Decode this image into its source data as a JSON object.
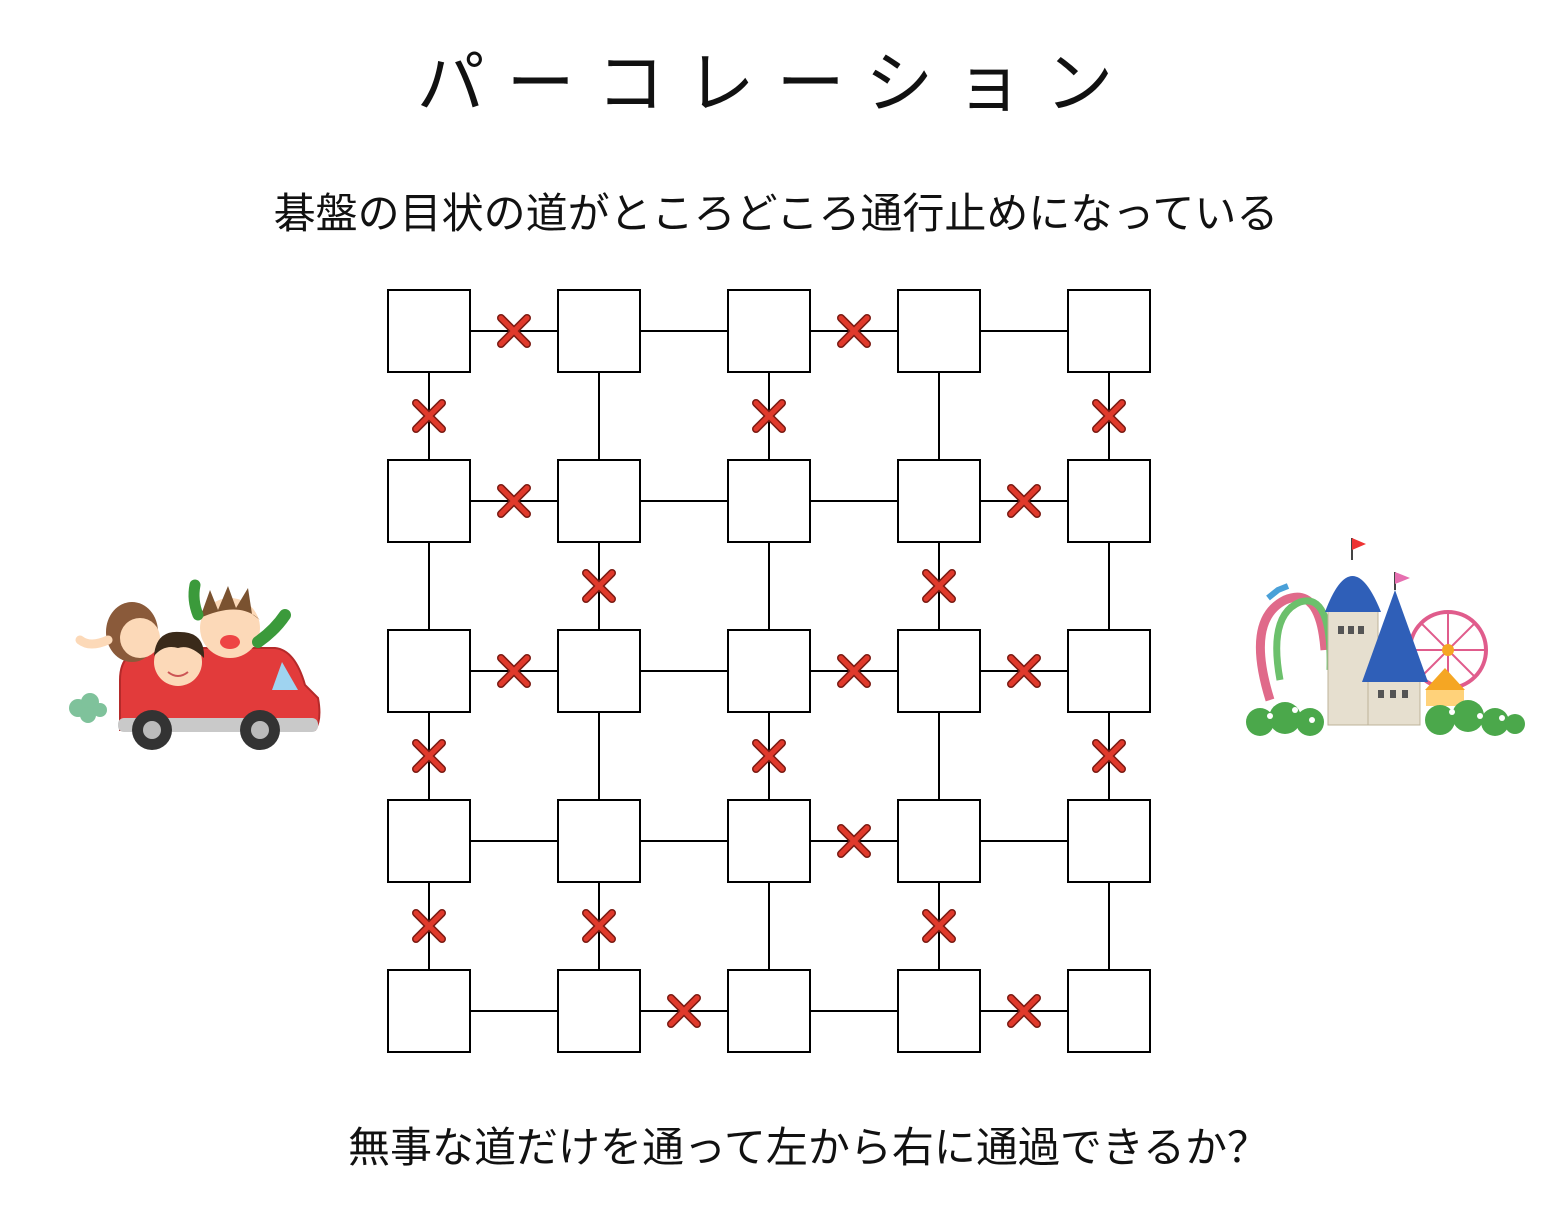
{
  "title": "パーコレーション",
  "subtitle": "碁盤の目状の道がところどころ通行止めになっている",
  "question": "無事な道だけを通って左から右に通過できるか？",
  "grid": {
    "rows": 5,
    "cols": 5,
    "blocked_horizontal": [
      [
        true,
        false,
        true,
        false
      ],
      [
        true,
        false,
        false,
        true
      ],
      [
        true,
        false,
        true,
        true
      ],
      [
        false,
        false,
        true,
        false
      ],
      [
        false,
        true,
        false,
        true
      ]
    ],
    "blocked_vertical": [
      [
        true,
        false,
        true,
        false,
        true
      ],
      [
        false,
        true,
        false,
        true,
        false
      ],
      [
        true,
        false,
        true,
        false,
        true
      ],
      [
        true,
        true,
        false,
        true,
        false
      ]
    ]
  },
  "illustrations": {
    "left": "family-car-illustration",
    "right": "amusement-park-illustration"
  },
  "colors": {
    "blocked_mark": "#e0392b",
    "line": "#000000",
    "node_fill": "#ffffff"
  }
}
